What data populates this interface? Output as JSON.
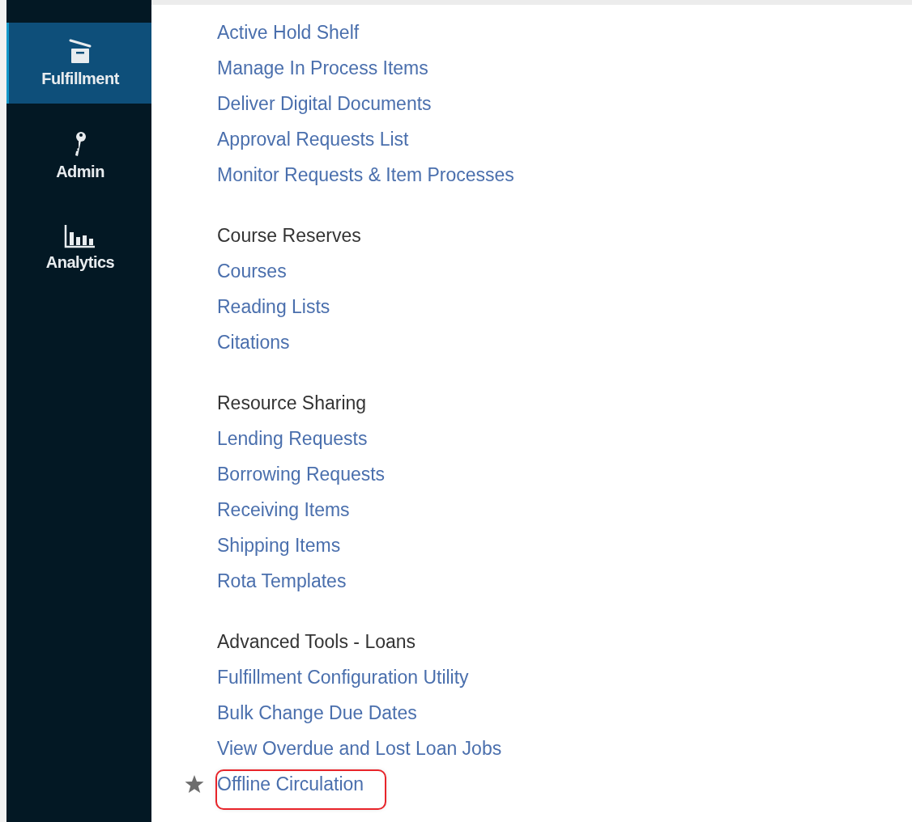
{
  "sidebar": {
    "items": [
      {
        "label": "Fulfillment",
        "selected": true
      },
      {
        "label": "Admin",
        "selected": false
      },
      {
        "label": "Analytics",
        "selected": false
      }
    ]
  },
  "sections": [
    {
      "links": [
        {
          "label": "Active Hold Shelf",
          "starred": false,
          "highlighted": false
        },
        {
          "label": "Manage In Process Items",
          "starred": false,
          "highlighted": false
        },
        {
          "label": "Deliver Digital Documents",
          "starred": false,
          "highlighted": false
        },
        {
          "label": "Approval Requests List",
          "starred": false,
          "highlighted": false
        },
        {
          "label": "Monitor Requests & Item Processes",
          "starred": false,
          "highlighted": false
        }
      ]
    },
    {
      "heading": "Course Reserves",
      "links": [
        {
          "label": "Courses",
          "starred": false,
          "highlighted": false
        },
        {
          "label": "Reading Lists",
          "starred": false,
          "highlighted": false
        },
        {
          "label": "Citations",
          "starred": false,
          "highlighted": false
        }
      ]
    },
    {
      "heading": "Resource Sharing",
      "links": [
        {
          "label": "Lending Requests",
          "starred": false,
          "highlighted": false
        },
        {
          "label": "Borrowing Requests",
          "starred": false,
          "highlighted": false
        },
        {
          "label": "Receiving Items",
          "starred": false,
          "highlighted": false
        },
        {
          "label": "Shipping Items",
          "starred": false,
          "highlighted": false
        },
        {
          "label": "Rota Templates",
          "starred": false,
          "highlighted": false
        }
      ]
    },
    {
      "heading": "Advanced Tools - Loans",
      "links": [
        {
          "label": "Fulfillment Configuration Utility",
          "starred": false,
          "highlighted": false
        },
        {
          "label": "Bulk Change Due Dates",
          "starred": false,
          "highlighted": false
        },
        {
          "label": "View Overdue and Lost Loan Jobs",
          "starred": false,
          "highlighted": false
        },
        {
          "label": "Offline Circulation",
          "starred": true,
          "highlighted": true
        }
      ]
    }
  ]
}
